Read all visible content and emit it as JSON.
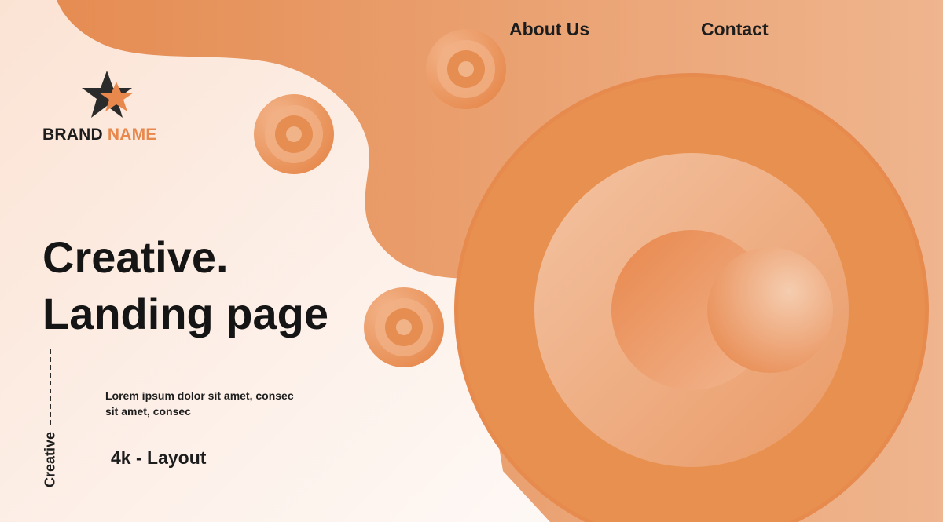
{
  "nav": {
    "about_label": "About Us",
    "contact_label": "Contact"
  },
  "brand": {
    "word1": "BRAND",
    "word2": "NAME",
    "logo_icon": "star-icon"
  },
  "hero": {
    "title_line1": "Creative.",
    "title_line2": "Landing page"
  },
  "description": {
    "line1": "Lorem ipsum dolor sit amet, consec",
    "line2": "sit amet, consec"
  },
  "layout_label": "4k - Layout",
  "side_label": "Creative",
  "colors": {
    "accent": "#e8884d",
    "accent_light": "#f0b38c",
    "text_dark": "#151515",
    "background": "#fbe3d4"
  }
}
